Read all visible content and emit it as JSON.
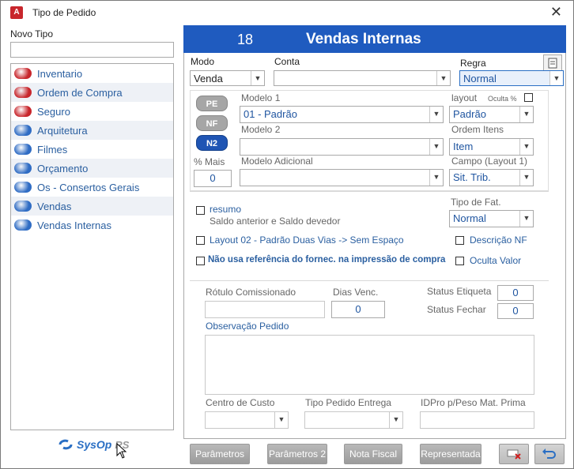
{
  "window": {
    "title": "Tipo de Pedido",
    "app_icon": "A",
    "close_glyph": "✕"
  },
  "left": {
    "label": "Novo Tipo",
    "new_value": "",
    "items": [
      {
        "label": "Inventario",
        "color": "#c8262c"
      },
      {
        "label": "Ordem de Compra",
        "color": "#c8262c"
      },
      {
        "label": "Seguro",
        "color": "#c8262c"
      },
      {
        "label": "Arquitetura",
        "color": "#2f6cc4"
      },
      {
        "label": "Filmes",
        "color": "#2f6cc4"
      },
      {
        "label": "Orçamento",
        "color": "#2f6cc4"
      },
      {
        "label": "Os - Consertos Gerais",
        "color": "#2f6cc4"
      },
      {
        "label": "Vendas",
        "color": "#2f6cc4"
      },
      {
        "label": "Vendas Internas",
        "color": "#2f6cc4"
      }
    ],
    "logo": {
      "name": "SysOp",
      "suffix": "RS"
    }
  },
  "header": {
    "number": "18",
    "name": "Vendas Internas",
    "color": "#1f5bbf"
  },
  "top": {
    "modo_label": "Modo",
    "modo_value": "Venda",
    "conta_label": "Conta",
    "conta_value": "",
    "regra_label": "Regra",
    "regra_value": "Normal"
  },
  "section1": {
    "pills": [
      "PE",
      "NF",
      "N2"
    ],
    "mais_label": "% Mais",
    "mais_value": "0",
    "modelo1_label": "Modelo 1",
    "modelo1_value": "01 - Padrão",
    "modelo2_label": "Modelo 2",
    "modelo2_value": "",
    "adicional_label": "Modelo Adicional",
    "adicional_value": "",
    "layout_label": "layout",
    "oculta_label": "Oculta %",
    "layout_value": "Padrão",
    "ordem_label": "Ordem Itens",
    "ordem_value": "Item",
    "campo_label": "Campo (Layout 1)",
    "campo_value": "Sit. Trib."
  },
  "section2": {
    "resumo_label": "resumo",
    "resumo_sub": "Saldo anterior e Saldo devedor",
    "tipo_fat_label": "Tipo de Fat.",
    "tipo_fat_value": "Normal",
    "layout02_label": "Layout 02 - Padrão Duas Vias -> Sem Espaço",
    "descricao_label": "Descrição NF",
    "nao_usa_label": "Não usa referência do fornec. na impressão de compra",
    "oculta_valor_label": "Oculta Valor"
  },
  "section3": {
    "rotulo_label": "Rótulo Comissionado",
    "dias_label": "Dias Venc.",
    "dias_value": "0",
    "status_etiqueta_label": "Status Etiqueta",
    "status_etiqueta_value": "0",
    "status_fechar_label": "Status Fechar",
    "status_fechar_value": "0",
    "obs_label": "Observação Pedido",
    "centro_label": "Centro de Custo",
    "tipo_entrega_label": "Tipo Pedido Entrega",
    "idpro_label": "IDPro p/Peso Mat. Prima"
  },
  "buttons": {
    "parametros": "Parâmetros",
    "parametros2": "Parâmetros 2",
    "nota_fiscal": "Nota Fiscal",
    "representada": "Representada"
  }
}
